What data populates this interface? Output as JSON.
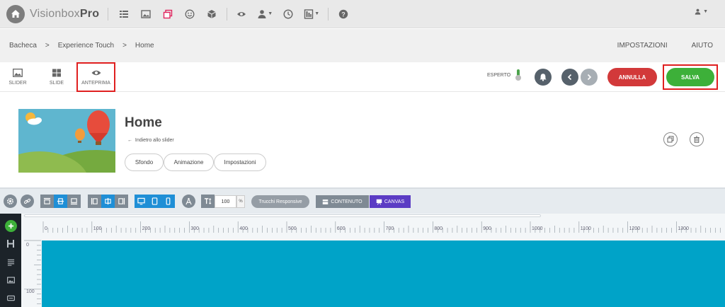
{
  "app": {
    "logo_text_light": "Visionbox",
    "logo_text_bold": "Pro",
    "toolbar_icons": [
      "list-icon",
      "image-icon",
      "layers-icon",
      "smile-icon",
      "cube-icon",
      "eye-icon",
      "user-tie-icon",
      "clock-icon",
      "calculator-icon",
      "help-icon"
    ],
    "user_icon": "user-icon"
  },
  "breadcrumb": {
    "items": [
      "Bacheca",
      "Experience Touch",
      "Home"
    ],
    "separator": ">"
  },
  "top_links": {
    "impostazioni": "IMPOSTAZIONI",
    "aiuto": "AIUTO"
  },
  "modes": [
    {
      "label": "SLIDER",
      "icon": "image-icon"
    },
    {
      "label": "SLIDE",
      "icon": "grid-icon"
    },
    {
      "label": "ANTEPRIMA",
      "icon": "eye-icon",
      "active": true
    }
  ],
  "actions": {
    "esperto_label": "ESPERTO",
    "annulla": "ANNULLA",
    "salva": "SALVA"
  },
  "slide": {
    "title": "Home",
    "back_link": "Indietro allo slider",
    "tabs": [
      "Sfondo",
      "Animazione",
      "Impostazioni"
    ]
  },
  "editor": {
    "zoom_value": "100",
    "zoom_unit": "%",
    "trucchi_label": "Trucchi Responsive",
    "contenuto_label": "CONTENUTO",
    "canvas_label": "CANVAS"
  },
  "ruler": {
    "h_labels": [
      "0",
      "100",
      "200",
      "300",
      "400",
      "500",
      "600",
      "700",
      "800",
      "900",
      "1000",
      "1100",
      "1200",
      "1300",
      "14"
    ],
    "v_labels": [
      "0",
      "100"
    ]
  },
  "colors": {
    "annulla": "#d2393a",
    "salva": "#3db039",
    "highlight": "#e02020",
    "toolbar_blue": "#1f8fd6",
    "canvas_purple": "#5b3cc4",
    "stage": "#00a3c8"
  }
}
